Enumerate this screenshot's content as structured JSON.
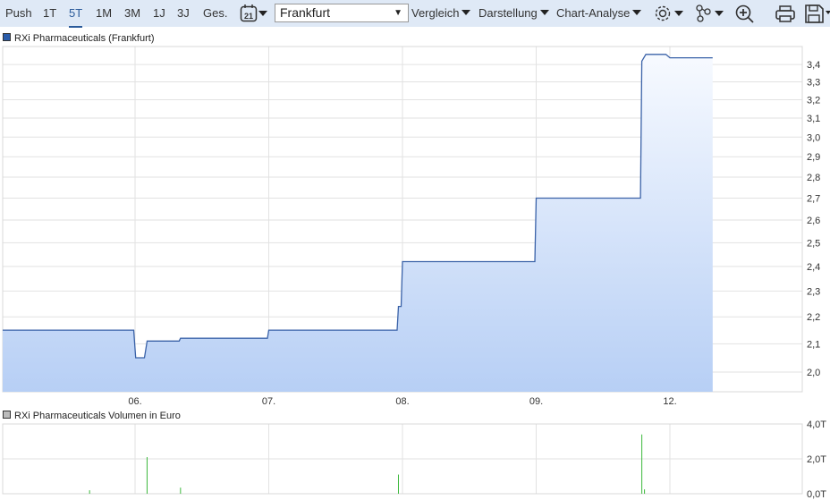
{
  "toolbar": {
    "ranges": [
      "Push",
      "1T",
      "5T",
      "1M",
      "3M",
      "1J",
      "3J",
      "Ges."
    ],
    "active_range": "5T",
    "calendar_day": "21",
    "exchange": "Frankfurt",
    "menus": [
      "Vergleich",
      "Darstellung",
      "Chart-Analyse"
    ],
    "icons": [
      "calendar-icon",
      "settings-gear-icon",
      "indicators-icon",
      "zoom-in-icon",
      "print-icon",
      "save-icon"
    ]
  },
  "price_chart": {
    "legend": "RXi Pharmaceuticals (Frankfurt)",
    "legend_color": "#2a5caa"
  },
  "volume_chart": {
    "legend": "RXi Pharmaceuticals Volumen in Euro",
    "legend_color": "#bbbbbb"
  },
  "chart_data": [
    {
      "type": "area",
      "title": "RXi Pharmaceuticals (Frankfurt)",
      "y_scale": "log",
      "ylim": [
        1.96,
        3.5
      ],
      "y_ticks": [
        "2,0",
        "2,1",
        "2,2",
        "2,3",
        "2,4",
        "2,5",
        "2,6",
        "2,7",
        "2,8",
        "2,9",
        "3,0",
        "3,1",
        "3,2",
        "3,3",
        "3,4"
      ],
      "y_tick_values": [
        2.0,
        2.1,
        2.2,
        2.3,
        2.4,
        2.5,
        2.6,
        2.7,
        2.8,
        2.9,
        3.0,
        3.1,
        3.2,
        3.3,
        3.4
      ],
      "x_ticks": [
        "06.",
        "07.",
        "08.",
        "09.",
        "12."
      ],
      "x_tick_positions": [
        1,
        2,
        3,
        4,
        5
      ],
      "grid": true,
      "line_color": "#3a62a8",
      "points": [
        [
          0.01,
          2.15
        ],
        [
          0.99,
          2.15
        ],
        [
          1.005,
          2.05
        ],
        [
          1.07,
          2.05
        ],
        [
          1.09,
          2.11
        ],
        [
          1.33,
          2.11
        ],
        [
          1.34,
          2.12
        ],
        [
          1.99,
          2.12
        ],
        [
          2.0,
          2.15
        ],
        [
          2.96,
          2.15
        ],
        [
          2.97,
          2.24
        ],
        [
          2.99,
          2.24
        ],
        [
          3.0,
          2.42
        ],
        [
          3.99,
          2.42
        ],
        [
          4.0,
          2.7
        ],
        [
          4.78,
          2.7
        ],
        [
          4.79,
          3.42
        ],
        [
          4.82,
          3.46
        ],
        [
          4.97,
          3.46
        ],
        [
          5.0,
          3.44
        ],
        [
          5.32,
          3.44
        ]
      ]
    },
    {
      "type": "bar",
      "title": "RXi Pharmaceuticals Volumen in Euro",
      "ylim": [
        0,
        4.0
      ],
      "y_ticks": [
        "0,0T",
        "2,0T",
        "4,0T"
      ],
      "y_tick_values": [
        0,
        2,
        4
      ],
      "bar_color": "#3cb83c",
      "bars": [
        [
          0.66,
          0.2
        ],
        [
          1.09,
          2.1
        ],
        [
          1.34,
          0.35
        ],
        [
          2.97,
          1.1
        ],
        [
          4.79,
          3.4
        ],
        [
          4.81,
          0.25
        ]
      ]
    }
  ]
}
